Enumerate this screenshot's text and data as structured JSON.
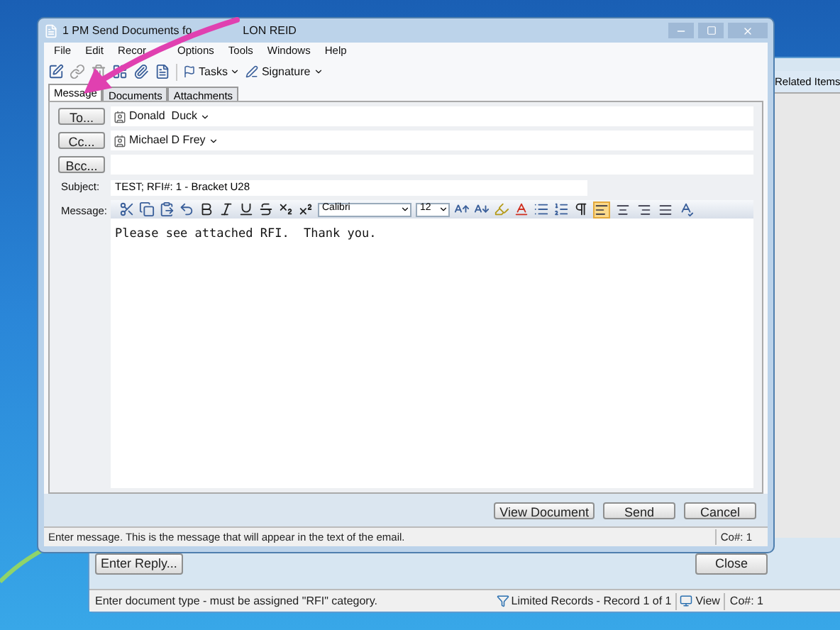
{
  "dialog": {
    "title_parts": [
      "1 PM Send Documents fo",
      "LON REID"
    ],
    "menu": [
      "File",
      "Edit",
      "Recor",
      "Options",
      "Tools",
      "Windows",
      "Help"
    ],
    "toolbar": [
      {
        "kind": "tasks",
        "label": "Tasks"
      },
      {
        "kind": "signature",
        "label": "Signature"
      }
    ],
    "tabs": [
      {
        "label": "Message",
        "selected": true
      },
      {
        "label": "Documents",
        "selected": false
      },
      {
        "label": "Attachments",
        "selected": false
      }
    ],
    "recipients": [
      {
        "button": "To...",
        "value": "Donald  Duck"
      },
      {
        "button": "Cc...",
        "value": "Michael D Frey"
      },
      {
        "button": "Bcc..."
      }
    ],
    "subject": {
      "label": "Subject:",
      "value": "TEST; RFI#: 1 - Bracket U28"
    },
    "message": {
      "label": "Message:",
      "font": "Calibri",
      "size": "12",
      "body": "Please see attached RFI.  Thank you.",
      "alignment": [
        {
          "kind": "left",
          "selected": true
        },
        {
          "kind": "center",
          "selected": false
        },
        {
          "kind": "right",
          "selected": false
        },
        {
          "kind": "justify",
          "selected": false
        }
      ]
    },
    "buttons": [
      "View Document",
      "Send",
      "Cancel"
    ],
    "status": {
      "text": "Enter message. This is the message that will appear in the text of the email.",
      "company": "Co#: 1"
    }
  },
  "background_window": {
    "side_panel": "Related Items",
    "reply_button": "Enter Reply...",
    "close_button": "Close",
    "status": {
      "text": "Enter document type - must be assigned \"RFI\" category.",
      "records": "Limited Records - Record 1 of 1",
      "mode": "View",
      "company": "Co#: 1"
    }
  }
}
